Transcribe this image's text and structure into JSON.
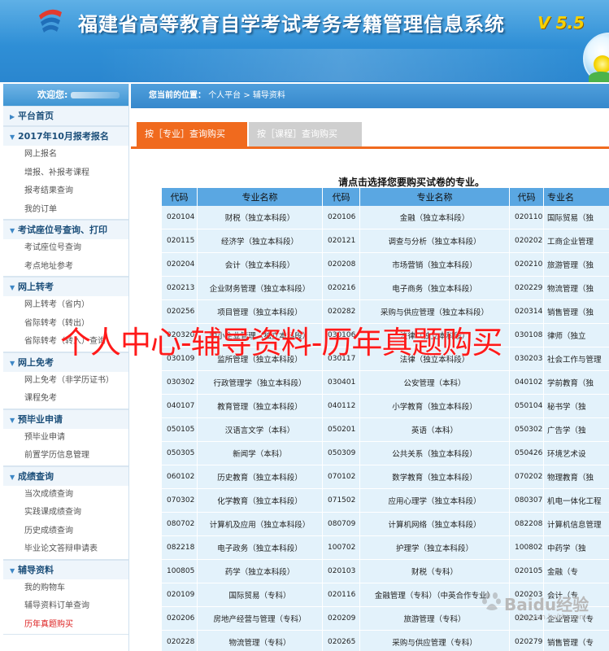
{
  "header": {
    "title": "福建省高等教育自学考试考务考籍管理信息系统",
    "version": "V 5.5",
    "colors": {
      "banner": "#2f8fd6",
      "title": "#ffffff",
      "version": "#f7d000"
    }
  },
  "sidebar": {
    "welcome": "欢迎您:",
    "sections": [
      {
        "title": "平台首页",
        "items": []
      },
      {
        "title": "2017年10月报考报名",
        "items": [
          "网上报名",
          "增报、补报考课程",
          "报考结果查询",
          "我的订单"
        ]
      },
      {
        "title": "考试座位号查询、打印",
        "items": [
          "考试座位号查询",
          "考点地址参考"
        ]
      },
      {
        "title": "网上转考",
        "items": [
          "网上转考（省内）",
          "省际转考（转出）",
          "省际转考（转入）查询"
        ]
      },
      {
        "title": "网上免考",
        "items": [
          "网上免考（非学历证书）",
          "课程免考"
        ]
      },
      {
        "title": "预毕业申请",
        "items": [
          "预毕业申请",
          "前置学历信息管理"
        ]
      },
      {
        "title": "成绩查询",
        "items": [
          "当次成绩查询",
          "实践课成绩查询",
          "历史成绩查询",
          "毕业论文答辩申请表"
        ]
      },
      {
        "title": "辅导资料",
        "items": [
          "我的购物车",
          "辅导资料订单查询",
          "历年真题购买"
        ],
        "active_item": "历年真题购买"
      }
    ]
  },
  "breadcrumb": {
    "prefix": "您当前的位置：",
    "path": "个人平台 > 辅导资料"
  },
  "tabs": [
    {
      "label": "按［专业］查询购买",
      "active": true
    },
    {
      "label": "按［课程］查询购买",
      "active": false
    }
  ],
  "prompt": "请点击选择您要购买试卷的专业。",
  "table": {
    "headers": [
      "代码",
      "专业名称",
      "代码",
      "专业名称",
      "代码",
      "专业名"
    ],
    "rows": [
      [
        "020104",
        "财税（独立本科段）",
        "020106",
        "金融（独立本科段）",
        "020110",
        "国际贸易（独"
      ],
      [
        "020115",
        "经济学（独立本科段）",
        "020121",
        "调查与分析（独立本科段）",
        "020202",
        "工商企业管理"
      ],
      [
        "020204",
        "会计（独立本科段）",
        "020208",
        "市场营销（独立本科段）",
        "020210",
        "旅游管理（独"
      ],
      [
        "020213",
        "企业财务管理（独立本科段）",
        "020216",
        "电子商务（独立本科段）",
        "020229",
        "物流管理（独"
      ],
      [
        "020256",
        "项目管理（独立本科段）",
        "020282",
        "采购与供应管理（独立本科段）",
        "020314",
        "销售管理（独"
      ],
      [
        "020320",
        "中小企业管理（独立本科段）",
        "030106",
        "法律（独立本科段）",
        "030108",
        "律师（独立"
      ],
      [
        "030109",
        "监所管理（独立本科段）",
        "030117",
        "法律（独立本科段）",
        "030203",
        "社会工作与管理"
      ],
      [
        "030302",
        "行政管理学（独立本科段）",
        "030401",
        "公安管理（本科）",
        "040102",
        "学前教育（独"
      ],
      [
        "040107",
        "教育管理（独立本科段）",
        "040112",
        "小学教育（独立本科段）",
        "050104",
        "秘书学（独"
      ],
      [
        "050105",
        "汉语言文学（本科）",
        "050201",
        "英语（本科）",
        "050302",
        "广告学（独"
      ],
      [
        "050305",
        "新闻学（本科）",
        "050309",
        "公共关系（独立本科段）",
        "050426",
        "环境艺术设"
      ],
      [
        "060102",
        "历史教育（独立本科段）",
        "070102",
        "数学教育（独立本科段）",
        "070202",
        "物理教育（独"
      ],
      [
        "070302",
        "化学教育（独立本科段）",
        "071502",
        "应用心理学（独立本科段）",
        "080307",
        "机电一体化工程"
      ],
      [
        "080702",
        "计算机及应用（独立本科段）",
        "080709",
        "计算机网络（独立本科段）",
        "082208",
        "计算机信息管理"
      ],
      [
        "082218",
        "电子政务（独立本科段）",
        "100702",
        "护理学（独立本科段）",
        "100802",
        "中药学（独"
      ],
      [
        "100805",
        "药学（独立本科段）",
        "020103",
        "财税（专科）",
        "020105",
        "金融（专"
      ],
      [
        "020109",
        "国际贸易（专科）",
        "020116",
        "金融管理（专科）（中英合作专业）",
        "020203",
        "会计（专"
      ],
      [
        "020206",
        "房地产经营与管理（专科）",
        "020209",
        "旅游管理（专科）",
        "020214",
        "企业管理（专"
      ],
      [
        "020228",
        "物流管理（专科）",
        "020265",
        "采购与供应管理（专科）",
        "020279",
        "销售管理（专"
      ]
    ]
  },
  "overlay_caption": "个人中心-辅导资料-历年真题购买",
  "watermark": {
    "text": "Baidu经验",
    "url": "jingyan.baidu.com"
  }
}
